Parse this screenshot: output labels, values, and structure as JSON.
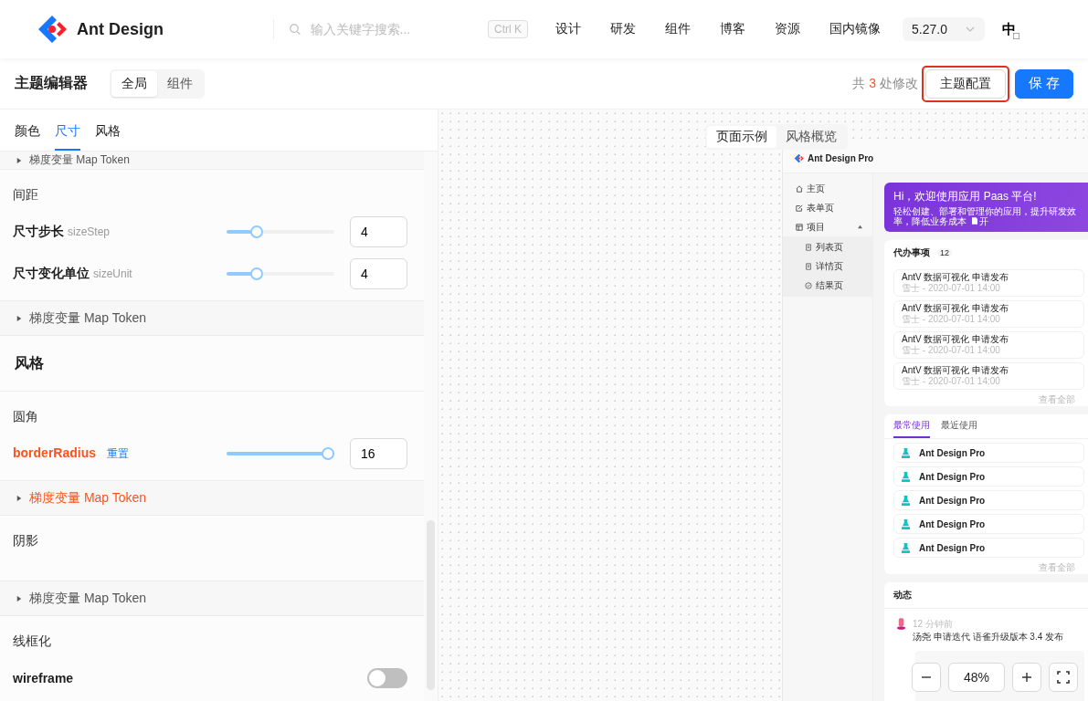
{
  "header": {
    "logo": "Ant Design",
    "search": {
      "placeholder": "输入关键字搜索..."
    },
    "shortcut": "Ctrl K",
    "nav": [
      "设计",
      "研发",
      "组件",
      "博客",
      "资源",
      "国内镜像"
    ],
    "version": "5.27.0",
    "language": {
      "label": "中",
      "selected": true
    }
  },
  "toolbar": {
    "title": "主题编辑器",
    "modes": [
      {
        "label": "全局",
        "selected": true
      },
      {
        "label": "组件",
        "selected": false
      }
    ],
    "changes": {
      "prefix": "共",
      "count": "3",
      "suffix": "处修改"
    },
    "config_button": {
      "label": "主题配置",
      "highlighted": true
    },
    "save_button": "保存"
  },
  "panel": {
    "tabs": [
      {
        "label": "颜色",
        "selected": false
      },
      {
        "label": "尺寸",
        "selected": true
      },
      {
        "label": "风格",
        "selected": false
      }
    ],
    "blocks": [
      {
        "kind": "collapse",
        "label": "梯度变量 Map Token",
        "modified": false
      },
      {
        "kind": "group",
        "title": "间距",
        "tokens": [
          {
            "kind": "slider",
            "label": "尺寸步长",
            "token": "sizeStep",
            "modified": false,
            "level": 0.25,
            "value": "4"
          },
          {
            "kind": "slider",
            "label": "尺寸变化单位",
            "token": "sizeUnit",
            "modified": false,
            "level": 0.25,
            "value": "4"
          }
        ]
      },
      {
        "kind": "collapse",
        "label": "梯度变量 Map Token",
        "modified": false
      },
      {
        "kind": "section",
        "title": "风格"
      },
      {
        "kind": "group",
        "title": "圆角",
        "tokens": [
          {
            "kind": "slider",
            "label": "borderRadius",
            "modified": true,
            "reset": "重置",
            "level": 1,
            "value": "16"
          }
        ]
      },
      {
        "kind": "collapse",
        "label": "梯度变量 Map Token",
        "modified": true
      },
      {
        "kind": "group",
        "title": "阴影"
      },
      {
        "kind": "collapse",
        "label": "梯度变量 Map Token",
        "modified": false
      },
      {
        "kind": "group",
        "title": "线框化",
        "tokens": [
          {
            "kind": "switch",
            "label": "wireframe",
            "modified": false,
            "on": false
          }
        ]
      }
    ]
  },
  "preview": {
    "views": [
      {
        "label": "页面示例",
        "selected": true
      },
      {
        "label": "风格概览",
        "selected": false
      }
    ],
    "app": {
      "title": "Ant Design Pro",
      "menu": [
        {
          "label": "主页"
        },
        {
          "label": "表单页"
        },
        {
          "label": "项目",
          "expanded": true,
          "children": [
            {
              "label": "列表页"
            },
            {
              "label": "详情页"
            },
            {
              "label": "结果页"
            }
          ]
        }
      ],
      "banner": {
        "title": "Hi，欢迎使用应用 Paas 平台!",
        "subtitle": "轻松创建、部署和管理你的应用，提升研发效率，降低业务成本",
        "link": "开"
      },
      "todo": {
        "title": "代办事项",
        "count": "12",
        "items": [
          {
            "title": "AntV 数据可视化 申请发布",
            "meta": "雪士 - 2020-07-01 14:00"
          },
          {
            "title": "AntV 数据可视化 申请发布",
            "meta": "雪士 - 2020-07-01 14:00"
          },
          {
            "title": "AntV 数据可视化 申请发布",
            "meta": "雪士 - 2020-07-01 14:00"
          },
          {
            "title": "AntV 数据可视化 申请发布",
            "meta": "雪士 - 2020-07-01 14:00"
          }
        ],
        "more": "查看全部"
      },
      "apps": {
        "tabs": [
          {
            "label": "最常使用",
            "selected": true
          },
          {
            "label": "最近使用",
            "selected": false
          }
        ],
        "items": [
          "Ant Design Pro",
          "Ant Design Pro",
          "Ant Design Pro",
          "Ant Design Pro",
          "Ant Design Pro"
        ],
        "more": "查看全部"
      },
      "activity": {
        "title": "动态",
        "items": [
          {
            "time": "12 分钟前",
            "text": "汤尧 申请迭代 语雀升级版本 3.4 发布"
          }
        ]
      }
    },
    "zoom": "48%"
  }
}
